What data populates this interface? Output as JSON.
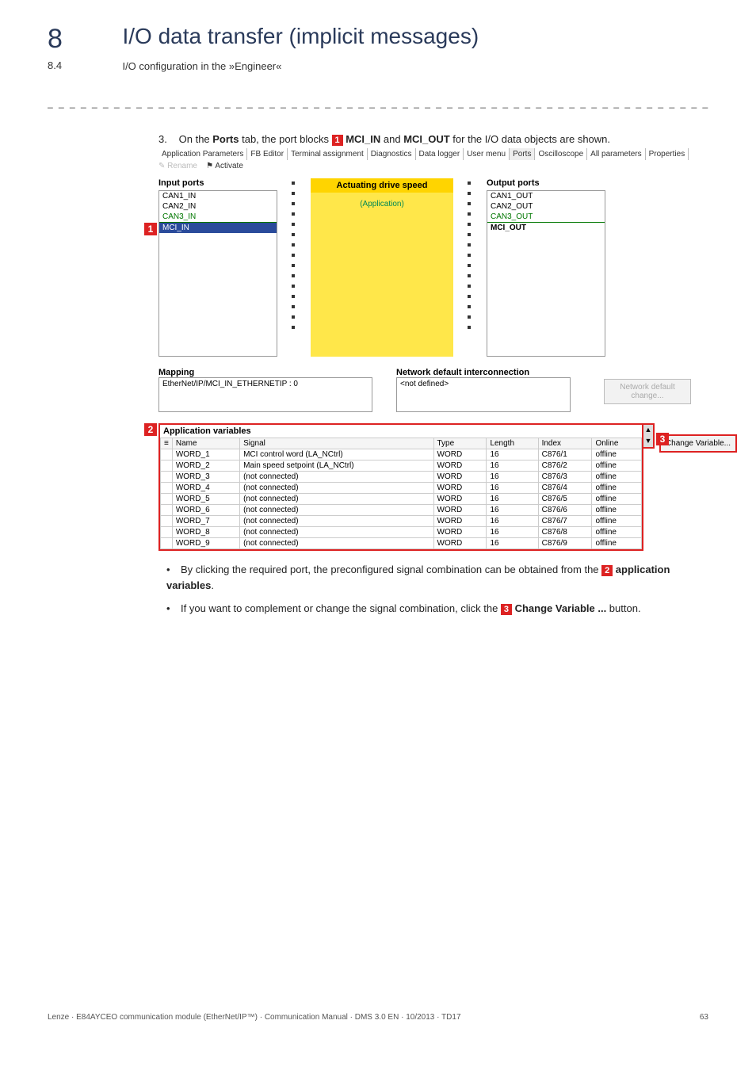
{
  "chapter": {
    "num": "8",
    "title": "I/O data transfer (implicit messages)"
  },
  "section": {
    "num": "8.4",
    "title": "I/O configuration in the »Engineer«"
  },
  "step": {
    "num": "3.",
    "text_pre": "On the ",
    "ports_word": "Ports",
    "text_mid1": " tab, the port blocks ",
    "marker1": "1",
    "mci_in": "MCI_IN",
    "and": " and ",
    "mci_out": "MCI_OUT",
    "text_post": " for the I/O data objects are shown."
  },
  "tabs": [
    "Application Parameters",
    "FB Editor",
    "Terminal assignment",
    "Diagnostics",
    "Data logger",
    "User menu",
    "Ports",
    "Oscilloscope",
    "All parameters",
    "Properties"
  ],
  "toolbar": {
    "rename": "Rename",
    "activate": "Activate"
  },
  "ports": {
    "input_label": "Input ports",
    "output_label": "Output ports",
    "ads_header": "Actuating drive speed",
    "ads_body": "(Application)",
    "inputs": [
      "CAN1_IN",
      "CAN2_IN",
      "CAN3_IN",
      "MCI_IN"
    ],
    "outputs": [
      "CAN1_OUT",
      "CAN2_OUT",
      "CAN3_OUT",
      "MCI_OUT"
    ]
  },
  "mapping": {
    "label": "Mapping",
    "value": "EtherNet/IP/MCI_IN_ETHERNETIP : 0",
    "ndi_label": "Network default interconnection",
    "ndi_value": "<not defined>",
    "ndc_btn": "Network default change..."
  },
  "appvar": {
    "marker": "2",
    "title": "Application variables",
    "headers": [
      "Name",
      "Signal",
      "Type",
      "Length",
      "Index",
      "Online"
    ],
    "rows": [
      {
        "name": "WORD_1",
        "signal": "MCI control word (LA_NCtrl)",
        "type": "WORD",
        "length": "16",
        "index": "C876/1",
        "online": "offline"
      },
      {
        "name": "WORD_2",
        "signal": "Main speed setpoint (LA_NCtrl)",
        "type": "WORD",
        "length": "16",
        "index": "C876/2",
        "online": "offline"
      },
      {
        "name": "WORD_3",
        "signal": "(not connected)",
        "type": "WORD",
        "length": "16",
        "index": "C876/3",
        "online": "offline"
      },
      {
        "name": "WORD_4",
        "signal": "(not connected)",
        "type": "WORD",
        "length": "16",
        "index": "C876/4",
        "online": "offline"
      },
      {
        "name": "WORD_5",
        "signal": "(not connected)",
        "type": "WORD",
        "length": "16",
        "index": "C876/5",
        "online": "offline"
      },
      {
        "name": "WORD_6",
        "signal": "(not connected)",
        "type": "WORD",
        "length": "16",
        "index": "C876/6",
        "online": "offline"
      },
      {
        "name": "WORD_7",
        "signal": "(not connected)",
        "type": "WORD",
        "length": "16",
        "index": "C876/7",
        "online": "offline"
      },
      {
        "name": "WORD_8",
        "signal": "(not connected)",
        "type": "WORD",
        "length": "16",
        "index": "C876/8",
        "online": "offline"
      },
      {
        "name": "WORD_9",
        "signal": "(not connected)",
        "type": "WORD",
        "length": "16",
        "index": "C876/9",
        "online": "offline"
      }
    ],
    "chg_marker": "3",
    "chg_btn": "Change Variable..."
  },
  "bullets": {
    "b1_pre": "By clicking the required port, the preconfigured signal combination can be obtained from the ",
    "b1_marker": "2",
    "b1_post_bold": "application variables",
    "b1_end": ".",
    "b2_pre": "If you want to complement or change the signal combination, click the ",
    "b2_marker": "3",
    "b2_bold": "Change Variable ...",
    "b2_post": " button."
  },
  "footer": {
    "left": "Lenze · E84AYCEO communication module (EtherNet/IP™) · Communication Manual · DMS 3.0 EN · 10/2013 · TD17",
    "right": "63"
  }
}
